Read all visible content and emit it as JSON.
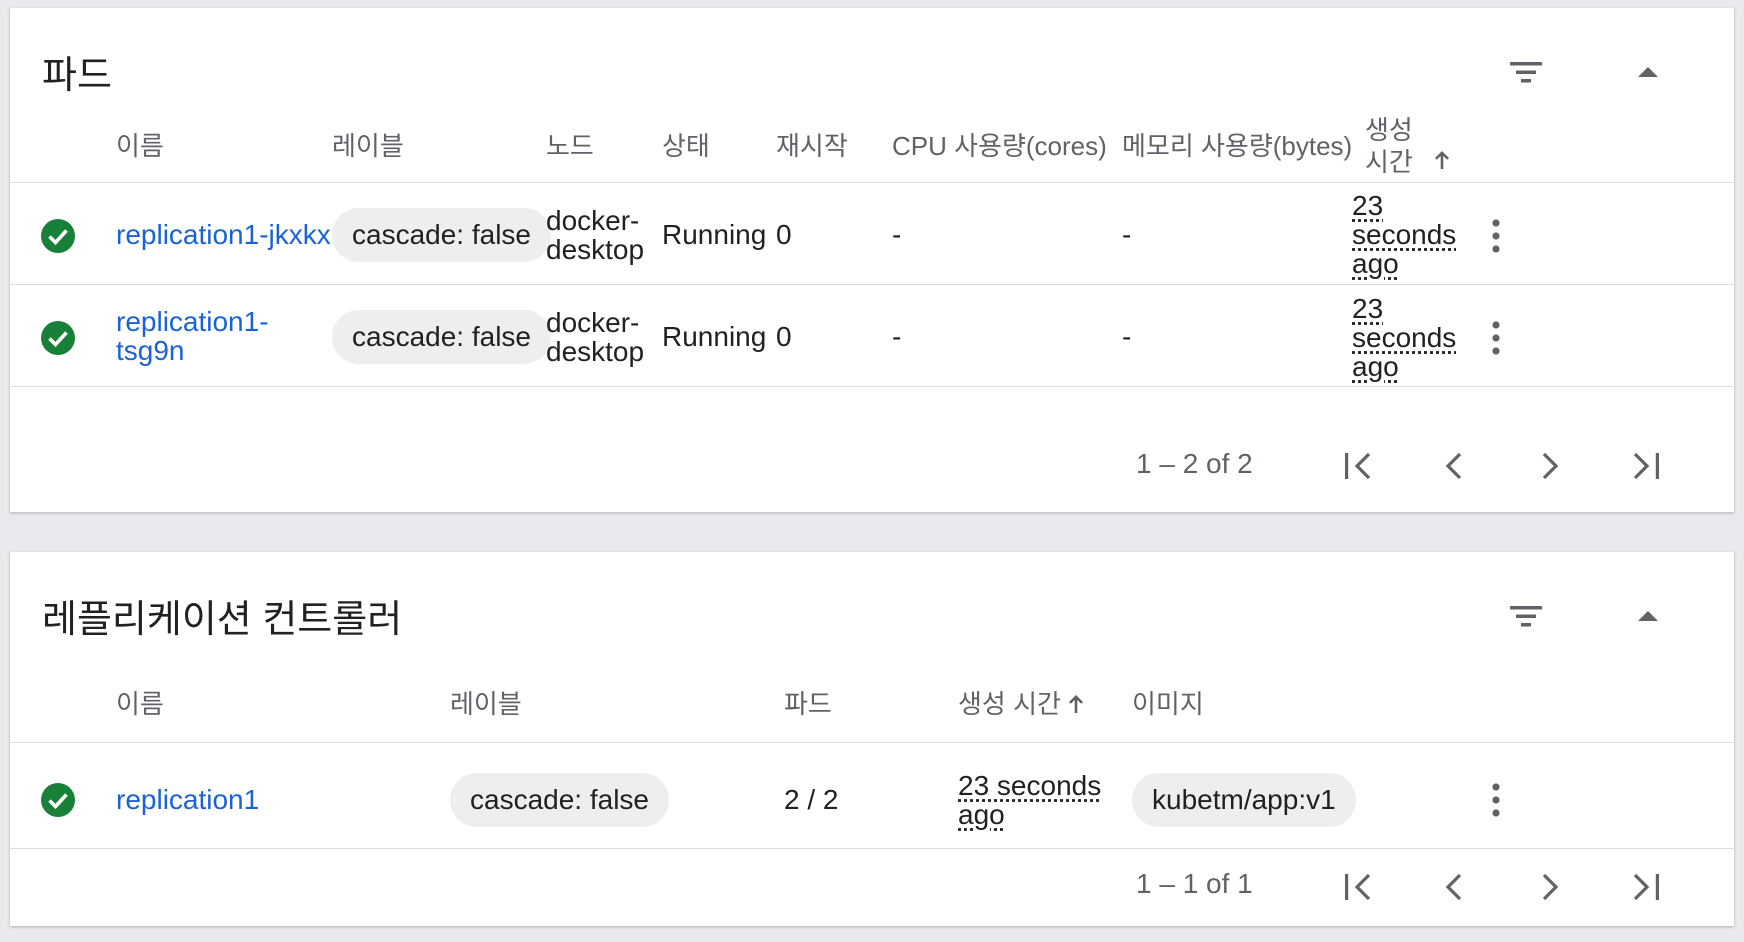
{
  "pods": {
    "title": "파드",
    "icons": {
      "filter": "filter-icon",
      "collapse": "collapse-up-icon"
    },
    "columns": {
      "name": "이름",
      "labels": "레이블",
      "node": "노드",
      "status": "상태",
      "restarts": "재시작",
      "cpu": "CPU 사용량(cores)",
      "memory": "메모리 사용량(bytes)",
      "created_line1": "생성",
      "created_line2": "시간"
    },
    "rows": [
      {
        "name_line1": "replication1-jkxkx",
        "name_line2": "",
        "label": "cascade: false",
        "node_line1": "docker-",
        "node_line2": "desktop",
        "status": "Running",
        "restarts": "0",
        "cpu": "-",
        "memory": "-",
        "created_line1": "23",
        "created_line2": "seconds",
        "created_line3": "ago"
      },
      {
        "name_line1": "replication1-",
        "name_line2": "tsg9n",
        "label": "cascade: false",
        "node_line1": "docker-",
        "node_line2": "desktop",
        "status": "Running",
        "restarts": "0",
        "cpu": "-",
        "memory": "-",
        "created_line1": "23",
        "created_line2": "seconds",
        "created_line3": "ago"
      }
    ],
    "pagination": {
      "range": "1 – 2 of 2"
    }
  },
  "replication_controllers": {
    "title": "레플리케이션 컨트롤러",
    "columns": {
      "name": "이름",
      "labels": "레이블",
      "pods": "파드",
      "created": "생성 시간",
      "images": "이미지"
    },
    "rows": [
      {
        "name": "replication1",
        "label": "cascade: false",
        "pods": "2 / 2",
        "created_line1": "23 seconds",
        "created_line2": "ago",
        "image": "kubetm/app:v1"
      }
    ],
    "pagination": {
      "range": "1 – 1 of 1"
    }
  },
  "colors": {
    "link": "#1a62d6",
    "status_ok": "#188038",
    "header_text": "#5f6368",
    "chip_bg": "#eeeeee",
    "page_bg": "#e8eaed"
  }
}
